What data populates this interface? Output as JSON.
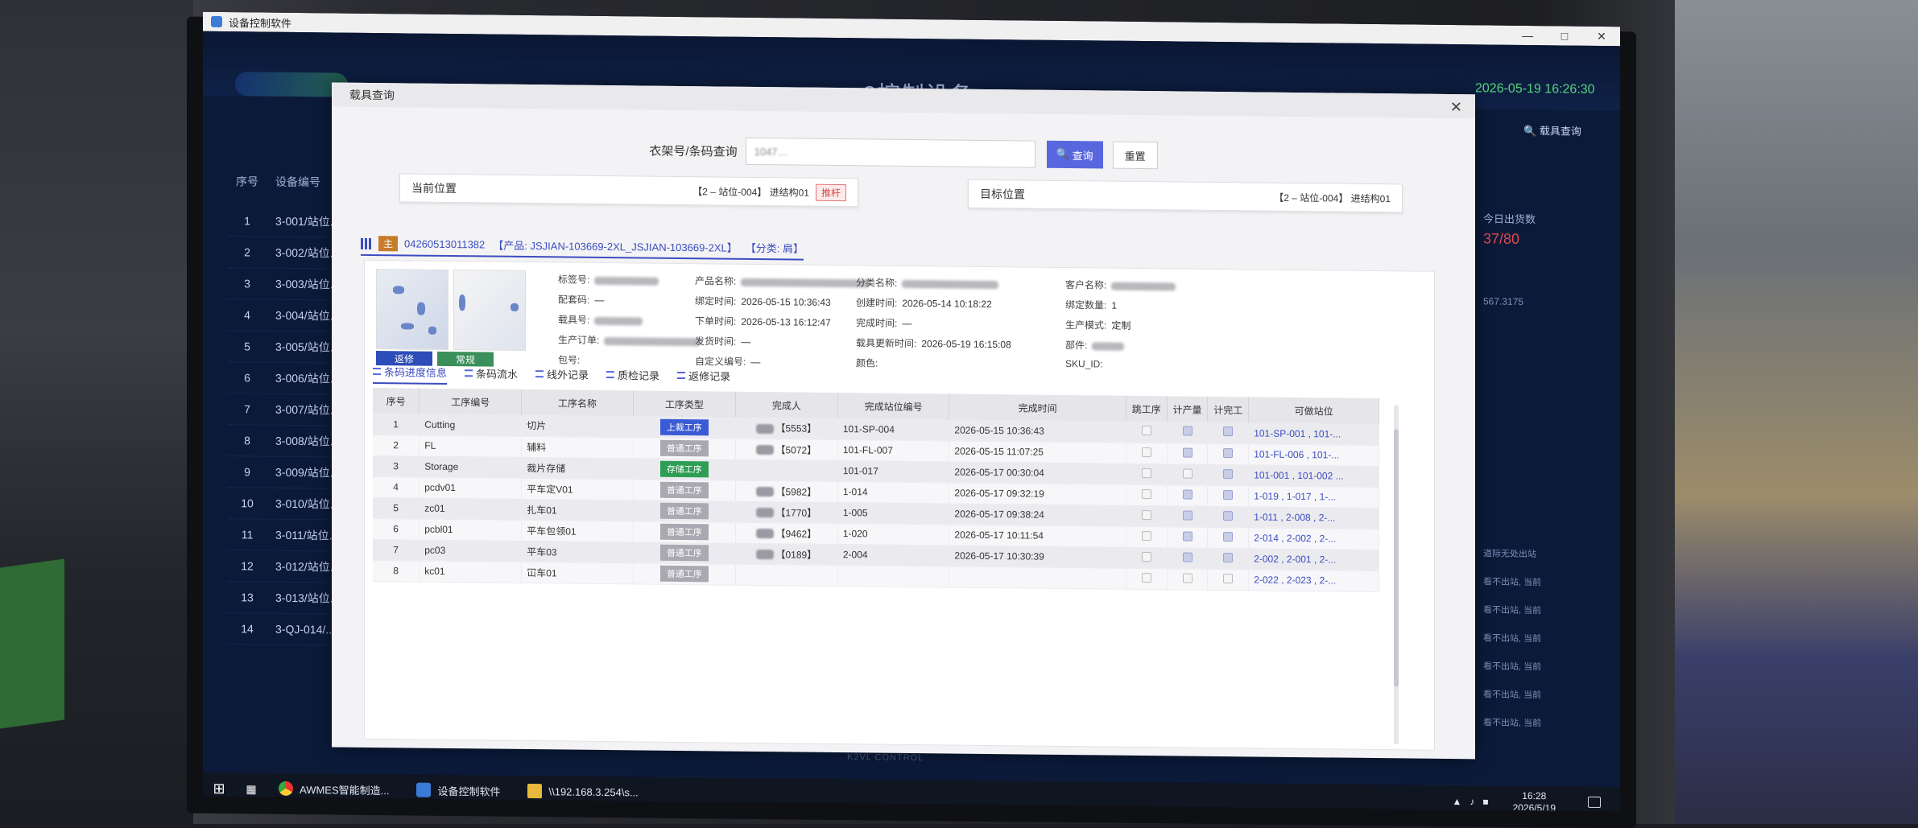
{
  "window": {
    "title": "设备控制软件"
  },
  "dashboard": {
    "title": "3控制设备",
    "datetime": "2026-05-19 16:26:30",
    "search_link": "载具查询",
    "table_head": [
      "序号",
      "设备编号"
    ],
    "rows": [
      [
        "1",
        "3-001/站位..."
      ],
      [
        "2",
        "3-002/站位..."
      ],
      [
        "3",
        "3-003/站位..."
      ],
      [
        "4",
        "3-004/站位..."
      ],
      [
        "5",
        "3-005/站位..."
      ],
      [
        "6",
        "3-006/站位..."
      ],
      [
        "7",
        "3-007/站位..."
      ],
      [
        "8",
        "3-008/站位..."
      ],
      [
        "9",
        "3-009/站位..."
      ],
      [
        "10",
        "3-010/站位..."
      ],
      [
        "11",
        "3-011/站位..."
      ],
      [
        "12",
        "3-012/站位..."
      ],
      [
        "13",
        "3-013/站位..."
      ],
      [
        "14",
        "3-QJ-014/..."
      ]
    ],
    "stat_label": "今日出货数",
    "stat_value": "37/80",
    "side_number": "567.3175",
    "log_lines": [
      "道际无处出站",
      "看不出站, 当前",
      "看不出站, 当前",
      "看不出站, 当前",
      "看不出站, 当前",
      "看不出站, 当前",
      "看不出站, 当前"
    ],
    "footer_brand": "K2VL CONTROL"
  },
  "modal": {
    "title": "载具查询",
    "search_label": "衣架号/条码查询",
    "search_value": "1047…",
    "search_btn": "查询",
    "reset_btn": "重置",
    "current_pos_title": "当前位置",
    "current_pos_value": "【2 – 站位-004】 进结构01",
    "current_pos_tag": "推杆",
    "target_pos_title": "目标位置",
    "target_pos_value": "【2 – 站位-004】 进结构01",
    "carrier_tag": "主",
    "carrier_code": "04260513011382",
    "carrier_product": "【产品: JSJIAN-103669-2XL_JSJIAN-103669-2XL】",
    "carrier_category": "【分类: 肩】",
    "btn_rework": "返修",
    "btn_normal": "常规",
    "fields": {
      "tag_no": "标签号:",
      "match_code": "配套码:",
      "match_code_v": "—",
      "carrier_no": "载具号:",
      "prod_order": "生产订单:",
      "pack_no": "包号:",
      "product_name": "产品名称:",
      "bind_time": "绑定时间:",
      "bind_time_v": "2026-05-15 10:36:43",
      "order_time": "下单时间:",
      "order_time_v": "2026-05-13 16:12:47",
      "ship_time": "发货时间:",
      "ship_time_v": "—",
      "custom_no": "自定义编号:",
      "custom_no_v": "—",
      "category_name": "分类名称:",
      "create_time": "创建时间:",
      "create_time_v": "2026-05-14 10:18:22",
      "finish_time": "完成时间:",
      "finish_time_v": "—",
      "carrier_update": "载具更新时间:",
      "carrier_update_v": "2026-05-19 16:15:08",
      "color": "颜色:",
      "customer": "客户名称:",
      "bind_qty": "绑定数量:",
      "bind_qty_v": "1",
      "prod_mode": "生产模式:",
      "prod_mode_v": "定制",
      "part": "部件:",
      "sku": "SKU_ID:"
    },
    "tabs": [
      "条码进度信息",
      "条码流水",
      "线外记录",
      "质检记录",
      "返修记录"
    ],
    "columns": [
      "序号",
      "工序编号",
      "工序名称",
      "工序类型",
      "完成人",
      "完成站位编号",
      "完成时间",
      "跳工序",
      "计产量",
      "计完工",
      "可做站位"
    ],
    "rows": [
      {
        "no": "1",
        "code": "Cutting",
        "name": "切片",
        "type": "上裁工序",
        "type_color": "#3b5bd6",
        "worker": "【5553】",
        "station": "101-SP-004",
        "time": "2026-05-15 10:36:43",
        "skip": false,
        "count": true,
        "done": true,
        "avail": "101-SP-001 , 101-..."
      },
      {
        "no": "2",
        "code": "FL",
        "name": "辅料",
        "type": "普通工序",
        "type_color": "#a9a9b1",
        "worker": "【5072】",
        "station": "101-FL-007",
        "time": "2026-05-15 11:07:25",
        "skip": false,
        "count": true,
        "done": true,
        "avail": "101-FL-006 , 101-..."
      },
      {
        "no": "3",
        "code": "Storage",
        "name": "裁片存储",
        "type": "存储工序",
        "type_color": "#2f9e55",
        "worker": "",
        "station": "101-017",
        "time": "2026-05-17 00:30:04",
        "skip": false,
        "count": false,
        "done": true,
        "avail": "101-001 , 101-002 ..."
      },
      {
        "no": "4",
        "code": "pcdv01",
        "name": "平车定V01",
        "type": "普通工序",
        "type_color": "#a9a9b1",
        "worker": "【5982】",
        "station": "1-014",
        "time": "2026-05-17 09:32:19",
        "skip": false,
        "count": true,
        "done": true,
        "avail": "1-019 , 1-017 , 1-..."
      },
      {
        "no": "5",
        "code": "zc01",
        "name": "扎车01",
        "type": "普通工序",
        "type_color": "#a9a9b1",
        "worker": "【1770】",
        "station": "1-005",
        "time": "2026-05-17 09:38:24",
        "skip": false,
        "count": true,
        "done": true,
        "avail": "1-011 , 2-008 , 2-..."
      },
      {
        "no": "6",
        "code": "pcbl01",
        "name": "平车包领01",
        "type": "普通工序",
        "type_color": "#a9a9b1",
        "worker": "【9462】",
        "station": "1-020",
        "time": "2026-05-17 10:11:54",
        "skip": false,
        "count": true,
        "done": true,
        "avail": "2-014 , 2-002 , 2-..."
      },
      {
        "no": "7",
        "code": "pc03",
        "name": "平车03",
        "type": "普通工序",
        "type_color": "#a9a9b1",
        "worker": "【0189】",
        "station": "2-004",
        "time": "2026-05-17 10:30:39",
        "skip": false,
        "count": true,
        "done": true,
        "avail": "2-002 , 2-001 , 2-..."
      },
      {
        "no": "8",
        "code": "kc01",
        "name": "冚车01",
        "type": "普通工序",
        "type_color": "#a9a9b1",
        "worker": "",
        "station": "",
        "time": "",
        "skip": false,
        "count": false,
        "done": false,
        "avail": "2-022 , 2-023 , 2-..."
      }
    ]
  },
  "taskbar": {
    "items": [
      "AWMES智能制造...",
      "设备控制软件",
      "\\\\192.168.3.254\\s..."
    ],
    "time": "16:28",
    "date": "2026/5/19"
  }
}
